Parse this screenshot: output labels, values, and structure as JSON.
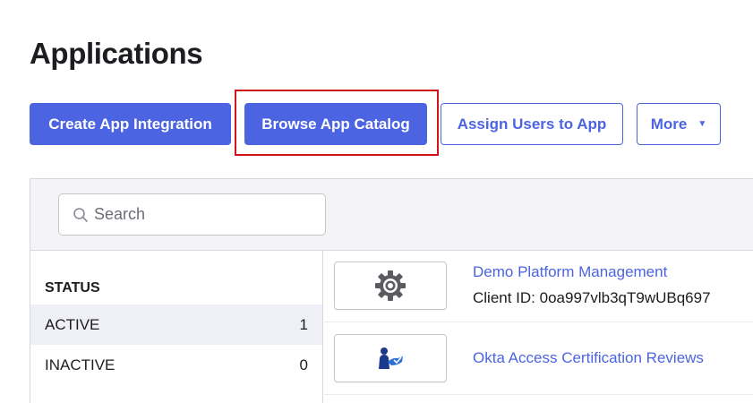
{
  "page": {
    "title": "Applications"
  },
  "actions": {
    "create_label": "Create App Integration",
    "browse_label": "Browse App Catalog",
    "assign_label": "Assign Users to App",
    "more_label": "More",
    "more_caret": "▼"
  },
  "search": {
    "placeholder": "Search",
    "value": "",
    "icon": "search-icon"
  },
  "status_filter": {
    "heading": "STATUS",
    "rows": [
      {
        "label": "ACTIVE",
        "count": "1",
        "selected": true
      },
      {
        "label": "INACTIVE",
        "count": "0",
        "selected": false
      }
    ]
  },
  "apps": [
    {
      "name": "Demo Platform Management",
      "client_id": "Client ID: 0oa997vlb3qT9wUBq697",
      "icon": "gear-icon"
    },
    {
      "name": "Okta Access Certification Reviews",
      "icon": "certification-icon"
    }
  ],
  "colors": {
    "primary": "#4c64e1",
    "highlight_border": "#d0161c",
    "panel_header_bg": "#f4f4f6",
    "selected_row_bg": "#eeeff7",
    "gear": "#5b5b61",
    "cert_icon": "#1c3a8c"
  }
}
